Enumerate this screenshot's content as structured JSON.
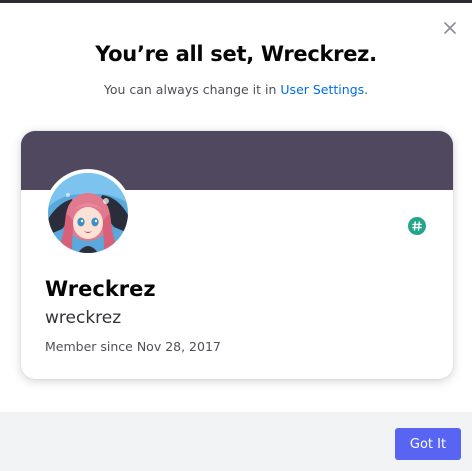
{
  "modal": {
    "title": "You’re all set, Wreckrez.",
    "subtitle_prefix": "You can always change it in ",
    "subtitle_link": "User Settings",
    "subtitle_suffix": ".",
    "close_icon": "close-icon"
  },
  "profile": {
    "display_name": "Wreckrez",
    "username": "wreckrez",
    "member_since": "Member since Nov 28, 2017",
    "avatar_icon": "avatar-image",
    "badge_icon": "hash-icon",
    "badge_symbol": "#"
  },
  "footer": {
    "primary_button": "Got It"
  },
  "colors": {
    "banner": "#4f485e",
    "badge": "#23a58c",
    "primary_button": "#5865f2",
    "link": "#006ce7",
    "footer_bg": "#f2f3f5"
  }
}
